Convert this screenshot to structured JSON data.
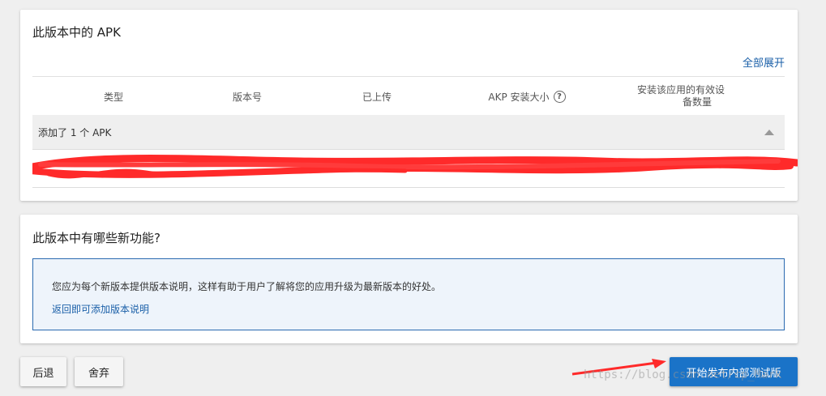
{
  "apk_section": {
    "title": "此版本中的 APK",
    "expand_all": "全部展开",
    "columns": [
      "类型",
      "版本号",
      "已上传",
      "AKP 安装大小",
      "安装该应用的有效设备数量"
    ],
    "column_last_line1": "安装该应用的有效设",
    "column_last_line2": "备数量",
    "group_label": "添加了 1 个 APK"
  },
  "new_features": {
    "title": "此版本中有哪些新功能?",
    "info_text": "您应为每个新版本提供版本说明，这样有助于用户了解将您的应用升级为最新版本的好处。",
    "info_link": "返回即可添加版本说明"
  },
  "footer": {
    "back_label": "后退",
    "discard_label": "舍弃",
    "publish_label": "开始发布内部测试版"
  },
  "watermark": "https://blog.csdn.net/cp_Mark",
  "colors": {
    "accent": "#1a73c8",
    "link": "#1a5fa8",
    "annotation": "#ff2a2a"
  }
}
